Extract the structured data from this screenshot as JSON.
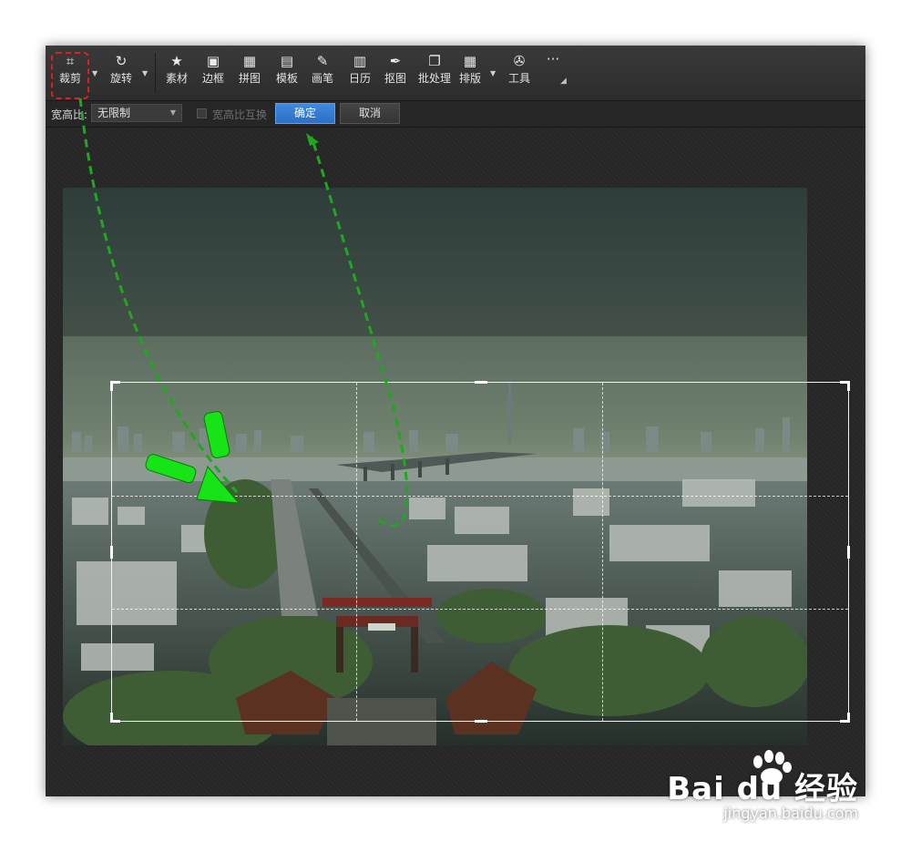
{
  "toolbar": {
    "items": [
      {
        "label": "裁剪",
        "icon": "crop-icon",
        "glyph": "⌗"
      },
      {
        "label": "旋转",
        "icon": "rotate-icon",
        "glyph": "↻"
      },
      {
        "label": "素材",
        "icon": "star-icon",
        "glyph": "★"
      },
      {
        "label": "边框",
        "icon": "frame-icon",
        "glyph": "▣"
      },
      {
        "label": "拼图",
        "icon": "grid-icon",
        "glyph": "▦"
      },
      {
        "label": "模板",
        "icon": "template-icon",
        "glyph": "▤"
      },
      {
        "label": "画笔",
        "icon": "brush-icon",
        "glyph": "✎"
      },
      {
        "label": "日历",
        "icon": "calendar-icon",
        "glyph": "▥"
      },
      {
        "label": "抠图",
        "icon": "pin-icon",
        "glyph": "✒"
      },
      {
        "label": "批处理",
        "icon": "batch-icon",
        "glyph": "❐"
      },
      {
        "label": "排版",
        "icon": "layout-icon",
        "glyph": "▦"
      },
      {
        "label": "工具",
        "icon": "wrench-icon",
        "glyph": "✇"
      }
    ],
    "more_glyph": "···"
  },
  "options": {
    "ratio_label": "宽高比:",
    "ratio_value": "无限制",
    "swap_label": "宽高比互换",
    "confirm_label": "确定",
    "cancel_label": "取消"
  },
  "watermark": {
    "logo_text": "Bai du 经验",
    "url": "jingyan.baidu.com"
  },
  "colors": {
    "highlight_red": "#e21d1d",
    "arrow_green": "#1fd41f",
    "confirm_blue": "#2f74cc"
  }
}
